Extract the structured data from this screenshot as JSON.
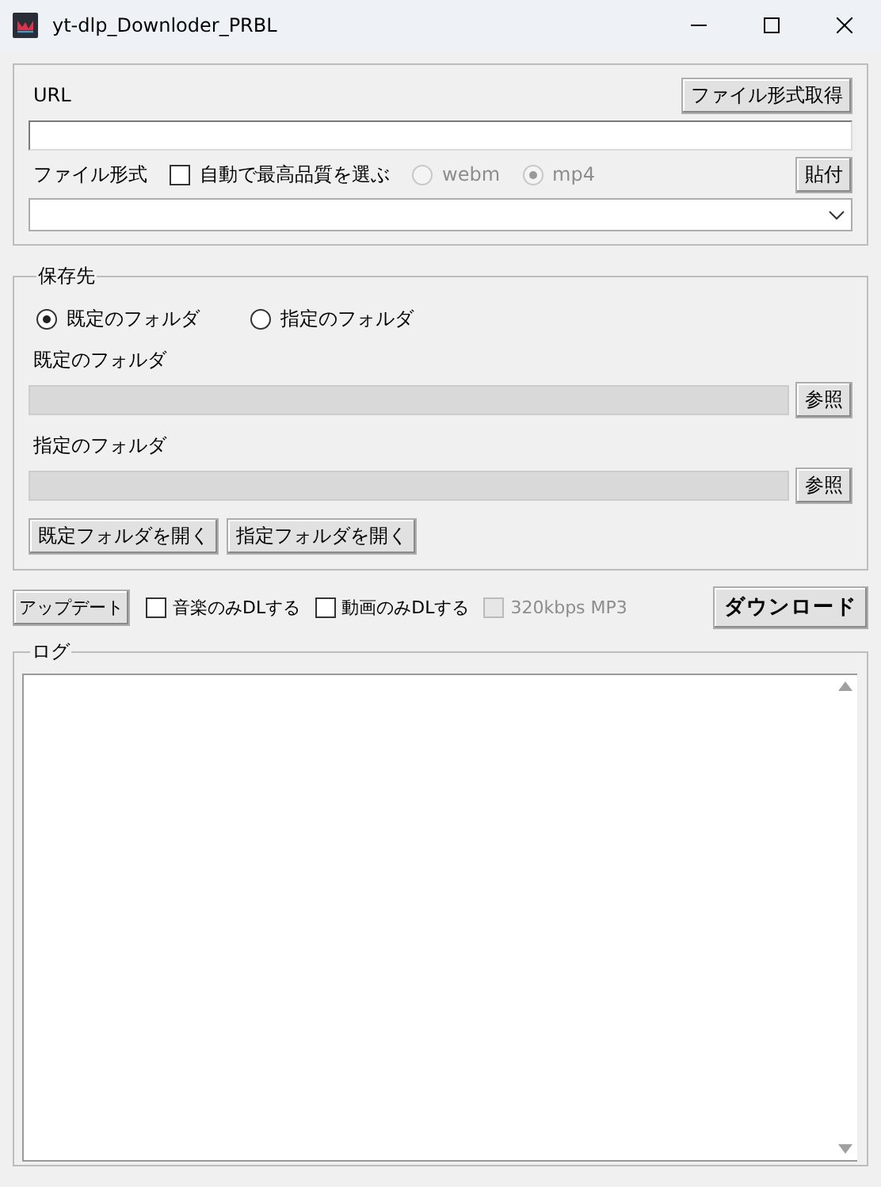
{
  "window": {
    "title": "yt-dlp_Downloder_PRBL"
  },
  "source": {
    "url_label": "URL",
    "fetch_button": "ファイル形式取得",
    "format_label": "ファイル形式",
    "auto_best": {
      "label": "自動で最高品質を選ぶ",
      "checked": false
    },
    "containers": [
      {
        "label": "webm",
        "selected": false,
        "disabled": true
      },
      {
        "label": "mp4",
        "selected": true,
        "disabled": true
      }
    ],
    "paste_button": "貼付"
  },
  "save": {
    "title": "保存先",
    "modes": [
      {
        "label": "既定のフォルダ",
        "selected": true
      },
      {
        "label": "指定のフォルダ",
        "selected": false
      }
    ],
    "folders": [
      {
        "label": "既定のフォルダ",
        "button": "参照",
        "disabled": true
      },
      {
        "label": "指定のフォルダ",
        "button": "参照",
        "disabled": true
      }
    ],
    "open_buttons": [
      "既定フォルダを開く",
      "指定フォルダを開く"
    ]
  },
  "actions": {
    "update_button": "アップデート",
    "options": [
      {
        "label": "音楽のみDLする",
        "checked": false,
        "disabled": false
      },
      {
        "label": "動画のみDLする",
        "checked": false,
        "disabled": false
      },
      {
        "label": "320kbps MP3",
        "checked": false,
        "disabled": true
      }
    ],
    "download_button": "ダウンロード"
  },
  "log": {
    "title": "ログ"
  }
}
